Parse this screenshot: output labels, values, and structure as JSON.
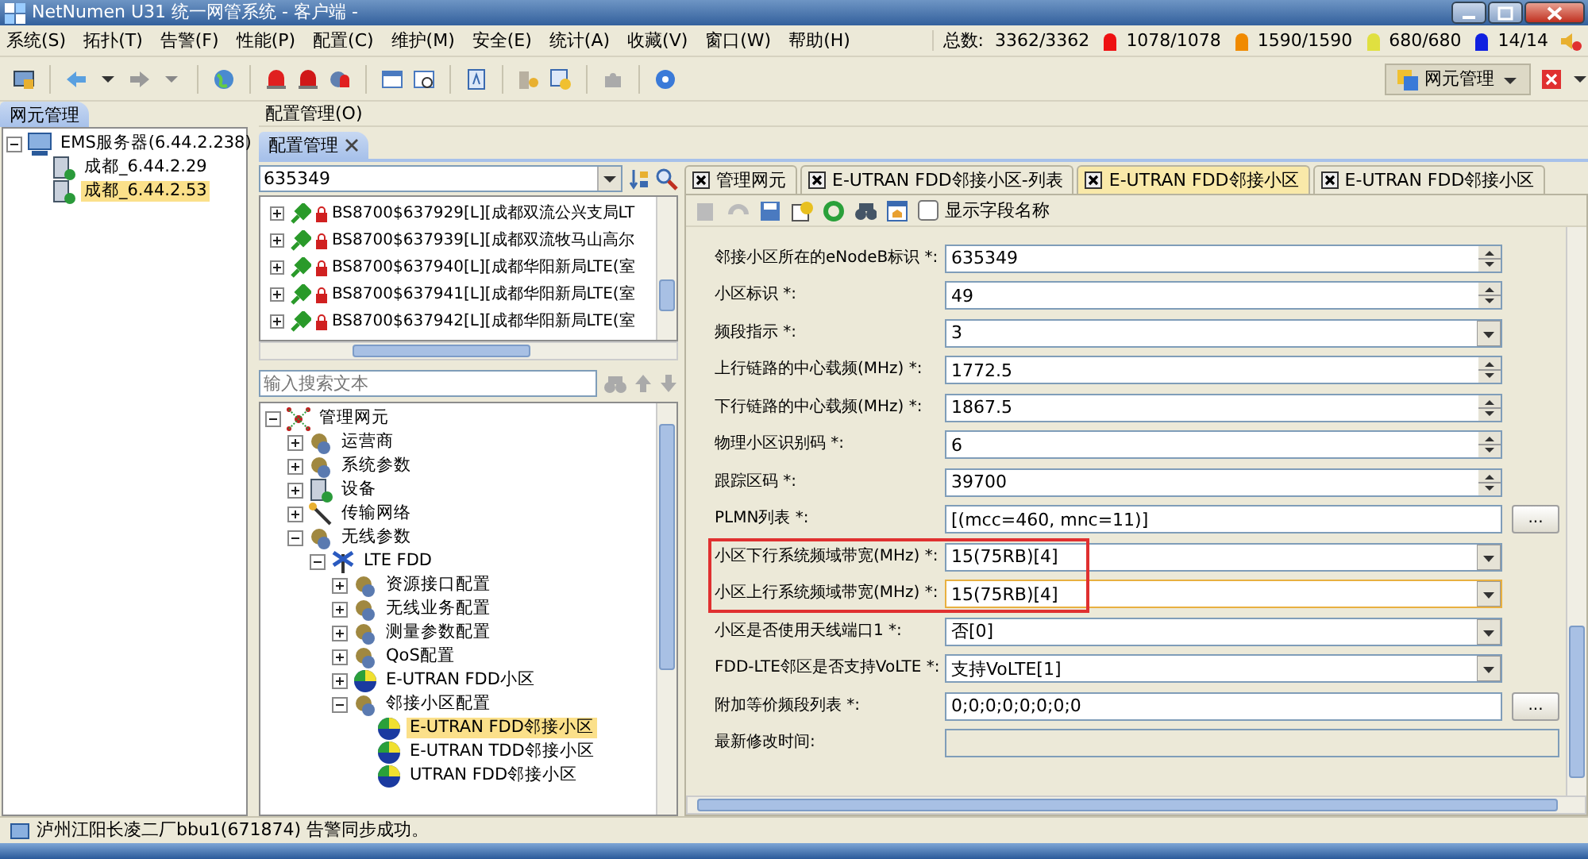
{
  "window": {
    "title": "NetNumen U31 统一网管系统 - 客户端 -"
  },
  "menu": [
    "系统(S)",
    "拓扑(T)",
    "告警(F)",
    "性能(P)",
    "配置(C)",
    "维护(M)",
    "安全(E)",
    "统计(A)",
    "收藏(V)",
    "窗口(W)",
    "帮助(H)"
  ],
  "alarm_summary": {
    "label": "总数:",
    "total": "3362/3362",
    "levels": [
      {
        "count": "1078/1078",
        "color": "#ee1111"
      },
      {
        "count": "1590/1590",
        "color": "#f08a00"
      },
      {
        "count": "680/680",
        "color": "#e0e040"
      },
      {
        "count": "14/14",
        "color": "#1020e0"
      }
    ]
  },
  "perspective": {
    "label": "网元管理"
  },
  "left_panel": {
    "tab": "网元管理",
    "tree": [
      {
        "label": "EMS服务器(6.44.2.238)",
        "kind": "server",
        "expanded": true,
        "selected": false,
        "children": [
          {
            "label": "成都_6.44.2.29",
            "kind": "device",
            "selected": false
          },
          {
            "label": "成都_6.44.2.53",
            "kind": "device",
            "selected": true
          }
        ]
      }
    ]
  },
  "config_header": "配置管理(O)",
  "middle_panel": {
    "tab": "配置管理",
    "query": "635349",
    "ne_list": [
      "BS8700$637929[L][成都双流公兴支局LT",
      "BS8700$637939[L][成都双流牧马山高尔",
      "BS8700$637940[L][成都华阳新局LTE(室",
      "BS8700$637941[L][成都华阳新局LTE(室",
      "BS8700$637942[L][成都华阳新局LTE(室"
    ],
    "search": {
      "placeholder": "输入搜索文本"
    },
    "tree": [
      {
        "label": "管理网元",
        "kind": "root",
        "expanded": true,
        "selected": false,
        "children": [
          {
            "label": "运营商",
            "kind": "category",
            "expanded": false,
            "selected": false
          },
          {
            "label": "系统参数",
            "kind": "category",
            "expanded": false,
            "selected": false
          },
          {
            "label": "设备",
            "kind": "device",
            "expanded": false,
            "selected": false
          },
          {
            "label": "传输网络",
            "kind": "transport",
            "expanded": false,
            "selected": false
          },
          {
            "label": "无线参数",
            "kind": "category",
            "expanded": true,
            "selected": false,
            "children": [
              {
                "label": "LTE FDD",
                "kind": "antenna",
                "expanded": true,
                "selected": false,
                "children": [
                  {
                    "label": "资源接口配置",
                    "kind": "category",
                    "expanded": false,
                    "selected": false
                  },
                  {
                    "label": "无线业务配置",
                    "kind": "category",
                    "expanded": false,
                    "selected": false
                  },
                  {
                    "label": "测量参数配置",
                    "kind": "category",
                    "expanded": false,
                    "selected": false
                  },
                  {
                    "label": "QoS配置",
                    "kind": "category",
                    "expanded": false,
                    "selected": false
                  },
                  {
                    "label": "E-UTRAN FDD小区",
                    "kind": "cell",
                    "expanded": false,
                    "selected": false
                  },
                  {
                    "label": "邻接小区配置",
                    "kind": "category",
                    "expanded": true,
                    "selected": false,
                    "children": [
                      {
                        "label": "E-UTRAN FDD邻接小区",
                        "kind": "cell",
                        "selected": true
                      },
                      {
                        "label": "E-UTRAN TDD邻接小区",
                        "kind": "cell",
                        "selected": false
                      },
                      {
                        "label": "UTRAN FDD邻接小区",
                        "kind": "cell",
                        "selected": false
                      }
                    ]
                  }
                ]
              }
            ]
          }
        ]
      }
    ]
  },
  "right_panel": {
    "tabs": [
      {
        "label": "管理网元",
        "selected": false
      },
      {
        "label": "E-UTRAN FDD邻接小区-列表",
        "selected": false
      },
      {
        "label": "E-UTRAN FDD邻接小区",
        "selected": true
      },
      {
        "label": "E-UTRAN FDD邻接小区",
        "selected": false
      }
    ],
    "show_field_names": {
      "label": "显示字段名称",
      "checked": false
    },
    "fields": [
      {
        "label": "邻接小区所在的eNodeB标识 *:",
        "value": "635349",
        "kind": "spin",
        "highlighted": false,
        "focused": false
      },
      {
        "label": "小区标识 *:",
        "value": "49",
        "kind": "spin",
        "highlighted": false,
        "focused": false
      },
      {
        "label": "频段指示 *:",
        "value": "3",
        "kind": "combo",
        "highlighted": false,
        "focused": false
      },
      {
        "label": "上行链路的中心载频(MHz) *:",
        "value": "1772.5",
        "kind": "spin",
        "highlighted": false,
        "focused": false
      },
      {
        "label": "下行链路的中心载频(MHz) *:",
        "value": "1867.5",
        "kind": "spin",
        "highlighted": false,
        "focused": false
      },
      {
        "label": "物理小区识别码 *:",
        "value": "6",
        "kind": "spin",
        "highlighted": false,
        "focused": false
      },
      {
        "label": "跟踪区码 *:",
        "value": "39700",
        "kind": "spin",
        "highlighted": false,
        "focused": false
      },
      {
        "label": "PLMN列表 *:",
        "value": "[(mcc=460, mnc=11)]",
        "kind": "list",
        "button": "...",
        "highlighted": false,
        "focused": false
      },
      {
        "label": "小区下行系统频域带宽(MHz) *:",
        "value": "15(75RB)[4]",
        "kind": "combo",
        "highlighted": true,
        "focused": false
      },
      {
        "label": "小区上行系统频域带宽(MHz) *:",
        "value": "15(75RB)[4]",
        "kind": "combo",
        "highlighted": true,
        "focused": true
      },
      {
        "label": "小区是否使用天线端口1 *:",
        "value": "否[0]",
        "kind": "combo",
        "highlighted": false,
        "focused": false
      },
      {
        "label": "FDD-LTE邻区是否支持VoLTE *:",
        "value": "支持VoLTE[1]",
        "kind": "combo",
        "highlighted": false,
        "focused": false
      },
      {
        "label": "附加等价频段列表 *:",
        "value": "0;0;0;0;0;0;0;0",
        "kind": "list",
        "button": "...",
        "highlighted": false,
        "focused": false
      },
      {
        "label": "最新修改时间:",
        "kind": "readonly",
        "highlighted": false,
        "focused": false
      }
    ]
  },
  "status_bar": {
    "message": "泸州江阳长凌二厂bbu1(671874) 告警同步成功。"
  }
}
